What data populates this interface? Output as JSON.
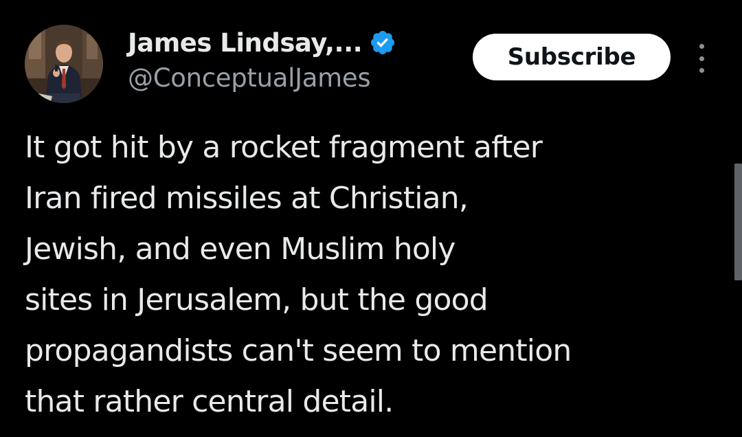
{
  "author": {
    "display_name": "James Lindsay,...",
    "handle": "@ConceptualJames",
    "verified": true,
    "verified_color": "#1d9bf0"
  },
  "actions": {
    "subscribe_label": "Subscribe",
    "more_icon": "more-vertical-icon"
  },
  "tweet": {
    "lines": [
      "It got hit by a rocket fragment after",
      "Iran fired missiles at Christian,",
      "Jewish, and even Muslim holy",
      "sites in Jerusalem, but the good",
      "propagandists can't seem to mention",
      "that rather central detail."
    ]
  },
  "colors": {
    "background": "#000000",
    "primary_text": "#e7e9ea",
    "secondary_text": "#9aa0a6",
    "button_bg": "#ffffff",
    "button_text": "#0f1419"
  }
}
